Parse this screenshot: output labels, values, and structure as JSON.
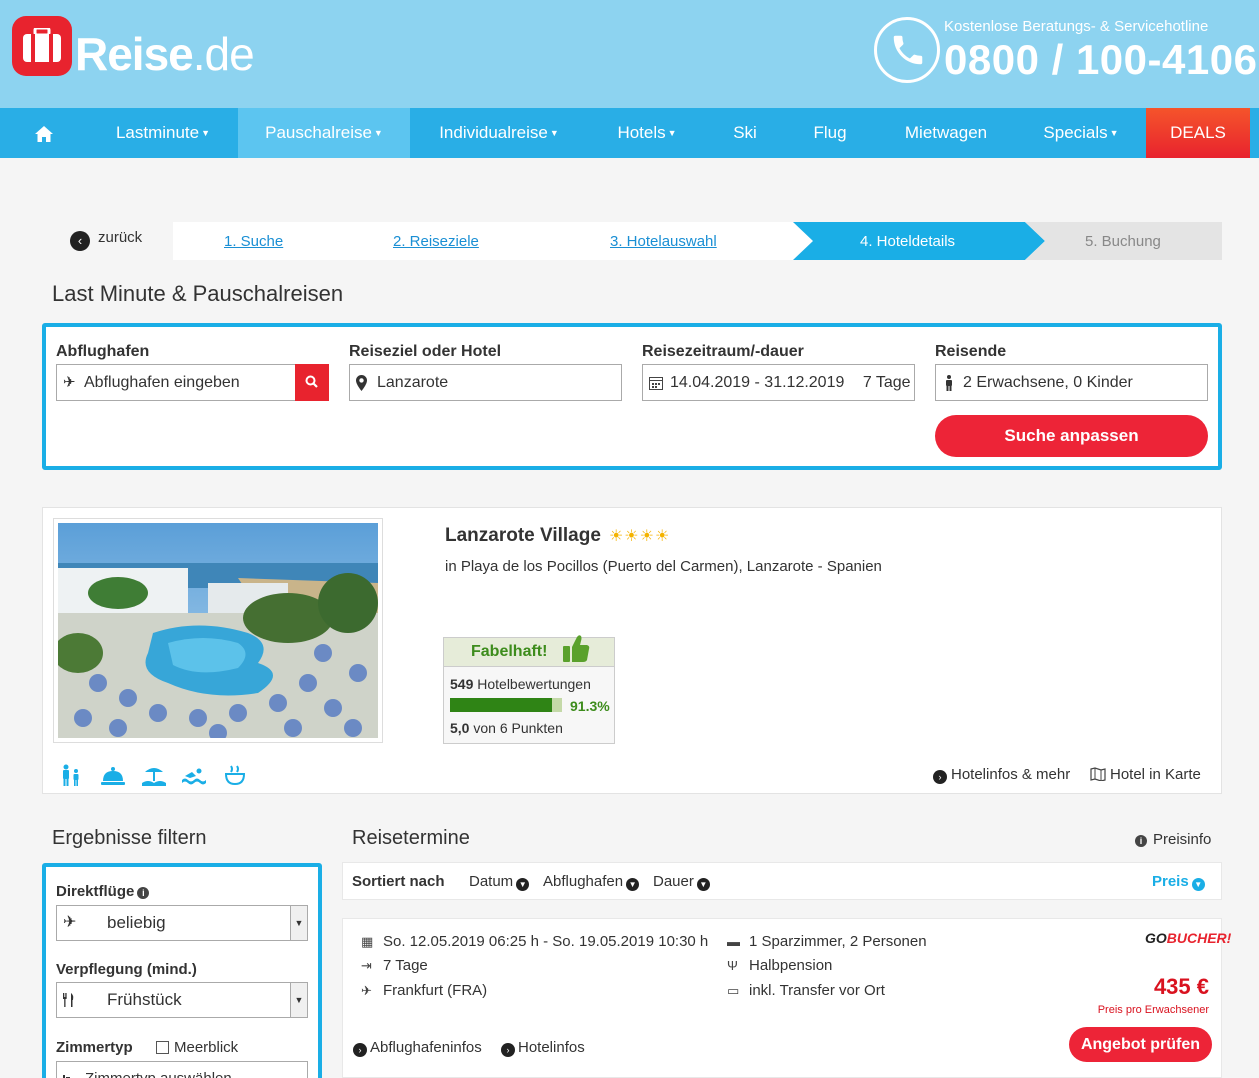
{
  "header": {
    "logo_main": "Reise",
    "logo_tld": ".de",
    "hotline_label": "Kostenlose Beratungs- & Servicehotline",
    "hotline_number": "0800 / 100-4106"
  },
  "nav": {
    "items": [
      {
        "label": "Lastminute",
        "dropdown": true
      },
      {
        "label": "Pauschalreise",
        "dropdown": true,
        "active": true
      },
      {
        "label": "Individualreise",
        "dropdown": true
      },
      {
        "label": "Hotels",
        "dropdown": true
      },
      {
        "label": "Ski"
      },
      {
        "label": "Flug"
      },
      {
        "label": "Mietwagen"
      },
      {
        "label": "Specials",
        "dropdown": true
      },
      {
        "label": "DEALS"
      }
    ]
  },
  "breadcrumb": {
    "back_label": "zurück",
    "steps": [
      "1. Suche",
      "2. Reiseziele",
      "3. Hotelauswahl",
      "4. Hoteldetails",
      "5. Buchung"
    ]
  },
  "page_title": "Last Minute & Pauschalreisen",
  "search": {
    "departure_label": "Abflughafen",
    "departure_placeholder": "Abflughafen eingeben",
    "destination_label": "Reiseziel oder Hotel",
    "destination_value": "Lanzarote",
    "period_label": "Reisezeitraum/-dauer",
    "period_value": "14.04.2019 - 31.12.2019",
    "duration_value": "7 Tage",
    "travelers_label": "Reisende",
    "travelers_value": "2 Erwachsene, 0 Kinder",
    "submit_label": "Suche anpassen"
  },
  "hotel": {
    "name": "Lanzarote Village",
    "stars": "☀☀☀☀",
    "location": "in Playa de los Pocillos (Puerto del Carmen), Lanzarote - Spanien",
    "rating_word": "Fabelhaft!",
    "review_count": "549",
    "review_label": "Hotelbewertungen",
    "recommendation_pct": "91.3%",
    "recommendation_value": 0.913,
    "score": "5,0",
    "score_suffix": "von 6 Punkten",
    "link_info": "Hotelinfos & mehr",
    "link_map": "Hotel in Karte",
    "amenities": [
      "family-icon",
      "room-service-icon",
      "beach-icon",
      "swimming-icon",
      "spa-icon"
    ]
  },
  "filter": {
    "title": "Ergebnisse filtern",
    "direct_label": "Direktflüge",
    "direct_value": "beliebig",
    "board_label": "Verpflegung (mind.)",
    "board_value": "Frühstück",
    "room_label": "Zimmertyp",
    "seaview_label": "Meerblick",
    "room_placeholder": "Zimmertyp auswählen"
  },
  "results": {
    "title": "Reisetermine",
    "price_info": "Preisinfo",
    "sort_label": "Sortiert nach",
    "sort_options": [
      "Datum",
      "Abflughafen",
      "Dauer",
      "Preis"
    ],
    "offer": {
      "dates": "So. 12.05.2019 06:25 h - So. 19.05.2019 10:30 h",
      "duration": "7 Tage",
      "airport": "Frankfurt (FRA)",
      "room": "1 Sparzimmer, 2 Personen",
      "board": "Halbpension",
      "transfer": "inkl. Transfer vor Ort",
      "operator_a": "GO",
      "operator_b": "BUCHER!",
      "price": "435 €",
      "price_note": "Preis pro Erwachsener",
      "cta": "Angebot prüfen",
      "link_airport": "Abflughafeninfos",
      "link_hotel": "Hotelinfos"
    }
  },
  "colors": {
    "header_bg": "#8dd3f0",
    "nav_bg": "#29aee6",
    "accent_red": "#e8232e",
    "accent_blue": "#1aaee6",
    "rating_green": "#3d8c1c"
  }
}
